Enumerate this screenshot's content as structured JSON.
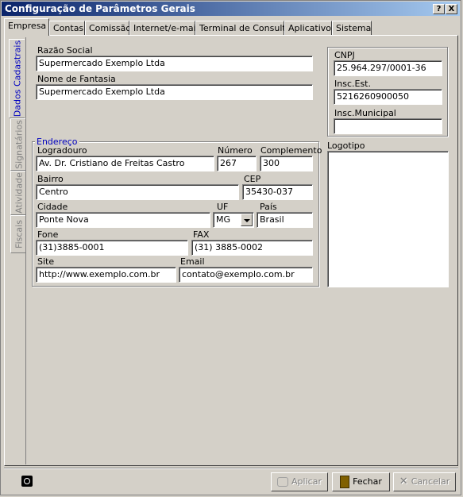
{
  "window": {
    "title": "Configuração de Parâmetros Gerais",
    "help_glyph": "?",
    "close_glyph": "X"
  },
  "tabs": [
    "Empresa",
    "Contas",
    "Comissão",
    "Internet/e-mail",
    "Terminal de Consulta",
    "Aplicativo",
    "Sistema"
  ],
  "side_tabs": [
    "Dados Cadastrais",
    "Signatários",
    "Atividade",
    "Fiscais"
  ],
  "company": {
    "razao_social_label": "Razão Social",
    "razao_social": "Supermercado Exemplo Ltda",
    "fantasia_label": "Nome de Fantasia",
    "fantasia": "Supermercado Exemplo Ltda"
  },
  "ids": {
    "cnpj_label": "CNPJ",
    "cnpj": "25.964.297/0001-36",
    "ie_label": "Insc.Est.",
    "ie": "5216260900050",
    "im_label": "Insc.Municipal",
    "im": ""
  },
  "address": {
    "group_title": "Endereço",
    "logradouro_label": "Logradouro",
    "logradouro": "Av. Dr. Cristiano de Freitas Castro",
    "numero_label": "Número",
    "numero": "267",
    "complemento_label": "Complemento",
    "complemento": "300",
    "bairro_label": "Bairro",
    "bairro": "Centro",
    "cep_label": "CEP",
    "cep": "35430-037",
    "cidade_label": "Cidade",
    "cidade": "Ponte Nova",
    "uf_label": "UF",
    "uf": "MG",
    "pais_label": "País",
    "pais": "Brasil",
    "fone_label": "Fone",
    "fone": "(31)3885-0001",
    "fax_label": "FAX",
    "fax": "(31) 3885-0002",
    "site_label": "Site",
    "site": "http://www.exemplo.com.br",
    "email_label": "Email",
    "email": "contato@exemplo.com.br"
  },
  "logo": {
    "label": "Logotipo"
  },
  "buttons": {
    "aplicar": "Aplicar",
    "fechar": "Fechar",
    "cancelar": "Cancelar"
  }
}
